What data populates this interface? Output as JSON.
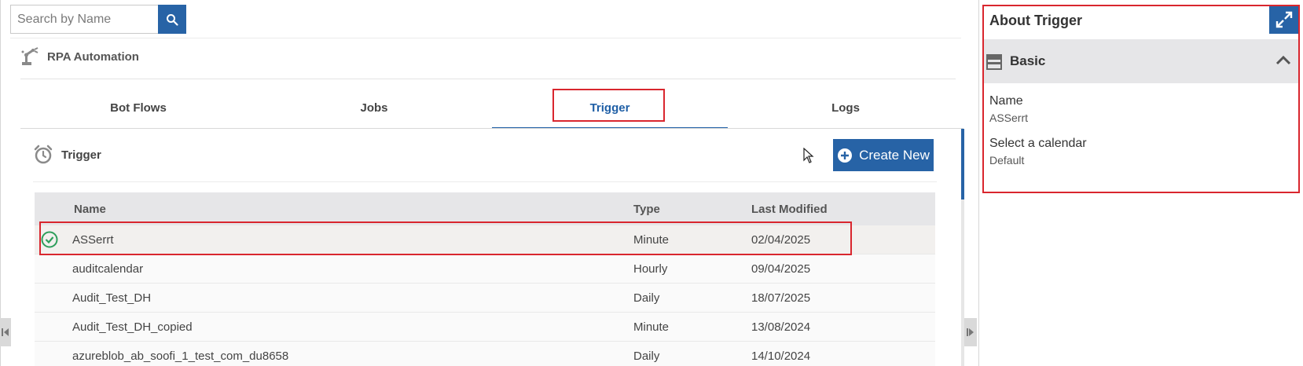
{
  "search": {
    "placeholder": "Search by Name"
  },
  "breadcrumb": {
    "label": "RPA Automation"
  },
  "tabs": [
    {
      "label": "Bot Flows",
      "active": false
    },
    {
      "label": "Jobs",
      "active": false
    },
    {
      "label": "Trigger",
      "active": true
    },
    {
      "label": "Logs",
      "active": false
    }
  ],
  "panel": {
    "title": "Trigger",
    "create_label": "Create New"
  },
  "table": {
    "columns": [
      "Name",
      "Type",
      "Last Modified"
    ],
    "rows": [
      {
        "name": "ASSerrt",
        "type": "Minute",
        "modified": "02/04/2025",
        "selected": true
      },
      {
        "name": "auditcalendar",
        "type": "Hourly",
        "modified": "09/04/2025",
        "selected": false
      },
      {
        "name": "Audit_Test_DH",
        "type": "Daily",
        "modified": "18/07/2025",
        "selected": false
      },
      {
        "name": "Audit_Test_DH_copied",
        "type": "Minute",
        "modified": "13/08/2024",
        "selected": false
      },
      {
        "name": "azureblob_ab_soofi_1_test_com_du8658",
        "type": "Daily",
        "modified": "14/10/2024",
        "selected": false
      }
    ]
  },
  "about": {
    "title": "About Trigger",
    "section": "Basic",
    "fields": [
      {
        "label": "Name",
        "value": "ASSerrt"
      },
      {
        "label": "Select a calendar",
        "value": "Default"
      }
    ]
  },
  "colors": {
    "accent": "#2763a6",
    "highlight": "#d9262e",
    "success": "#2e9e5b"
  },
  "icons": {
    "search": "search-icon",
    "robot": "robot-arm-icon",
    "alarm": "alarm-clock-icon",
    "plus": "plus-circle-icon",
    "check": "check-circle-icon",
    "expand": "expand-icon",
    "section": "section-icon",
    "chevron": "chevron-up-icon"
  }
}
